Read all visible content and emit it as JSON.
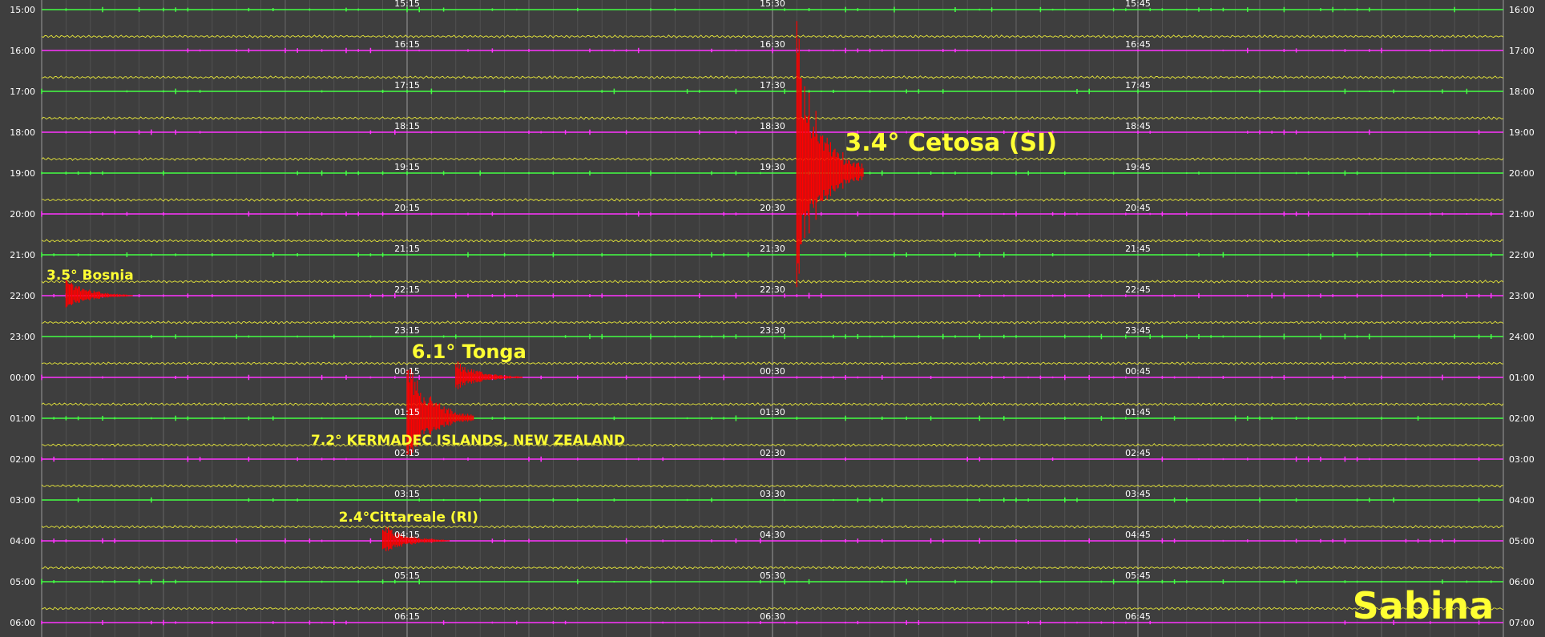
{
  "chart_data": {
    "type": "line",
    "station": "Sabina",
    "left_hours": [
      "15:00",
      "16:00",
      "17:00",
      "18:00",
      "19:00",
      "20:00",
      "21:00",
      "22:00",
      "23:00",
      "00:00",
      "01:00",
      "02:00",
      "03:00",
      "04:00",
      "05:00",
      "06:00"
    ],
    "right_hours": [
      "16:00",
      "17:00",
      "18:00",
      "19:00",
      "20:00",
      "21:00",
      "22:00",
      "23:00",
      "24:00",
      "01:00",
      "02:00",
      "03:00",
      "04:00",
      "05:00",
      "06:00",
      "07:00"
    ],
    "quarter_labels": [
      [
        "15:15",
        "15:30",
        "15:45"
      ],
      [
        "16:15",
        "16:30",
        "16:45"
      ],
      [
        "17:15",
        "17:30",
        "17:45"
      ],
      [
        "18:15",
        "18:30",
        "18:45"
      ],
      [
        "19:15",
        "19:30",
        "19:45"
      ],
      [
        "20:15",
        "20:30",
        "20:45"
      ],
      [
        "21:15",
        "21:30",
        "21:45"
      ],
      [
        "22:15",
        "22:30",
        "22:45"
      ],
      [
        "23:15",
        "23:30",
        "23:45"
      ],
      [
        "00:15",
        "00:30",
        "00:45"
      ],
      [
        "01:15",
        "01:30",
        "01:45"
      ],
      [
        "02:15",
        "02:30",
        "02:45"
      ],
      [
        "03:15",
        "03:30",
        "03:45"
      ],
      [
        "04:15",
        "04:30",
        "04:45"
      ],
      [
        "05:15",
        "05:30",
        "05:45"
      ],
      [
        "06:15",
        "06:30",
        "06:45"
      ]
    ],
    "minutes_per_row": 60,
    "trace_colors": [
      "#44ff44",
      "#ff33ff",
      "#ffff33"
    ],
    "event_color": "#ff0000",
    "events": [
      {
        "label": "3.4° Cetosa (SI)",
        "hour": "19:00",
        "minute": 31
      },
      {
        "label": "3.5° Bosnia",
        "hour": "22:00",
        "minute": 1
      },
      {
        "label": "6.1° Tonga",
        "hour": "00:00",
        "minute": 17
      },
      {
        "label": "7.2° KERMADEC ISLANDS, NEW ZEALAND",
        "hour": "01:00",
        "minute": 15
      },
      {
        "label": "2.4°Cittareale (RI)",
        "hour": "04:00",
        "minute": 14
      }
    ]
  }
}
